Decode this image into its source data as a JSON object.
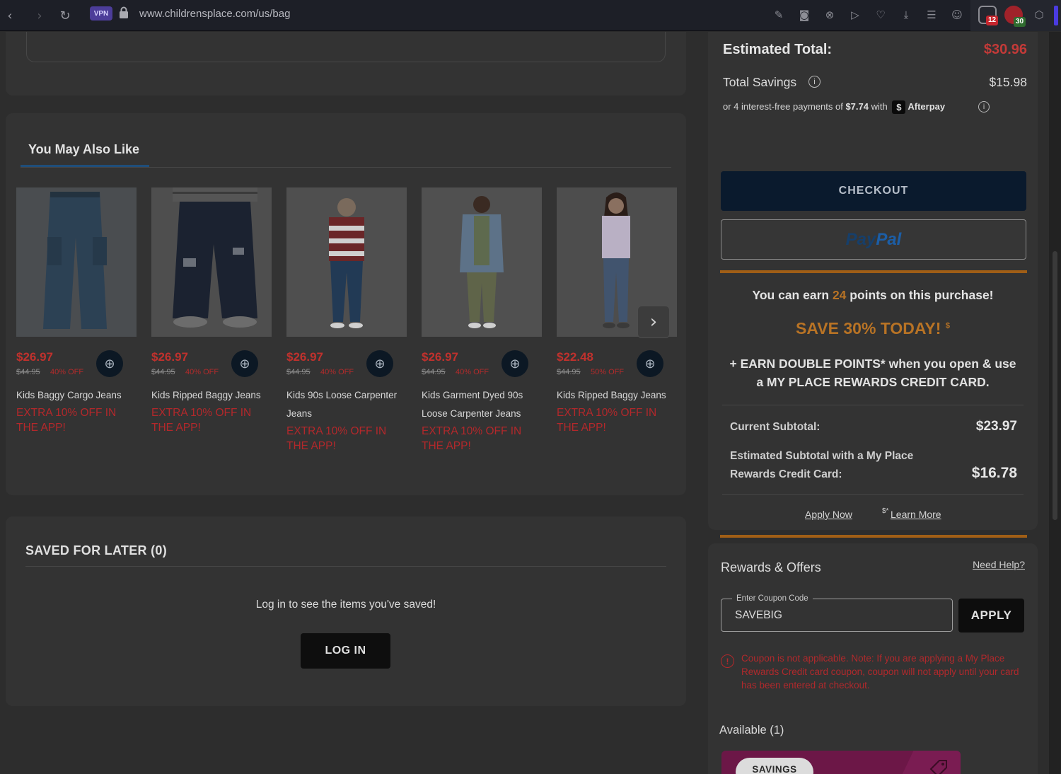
{
  "browser": {
    "vpn_label": "VPN",
    "url": "www.childrensplace.com/us/bag",
    "ext_badges": [
      "12",
      "30"
    ]
  },
  "recommendations": {
    "title": "You May Also Like",
    "products": [
      {
        "price": "$26.97",
        "original": "$44.95",
        "discount": "40% OFF",
        "name": "Kids Baggy Cargo Jeans",
        "promo": "EXTRA 10% OFF IN THE APP!"
      },
      {
        "price": "$26.97",
        "original": "$44.95",
        "discount": "40% OFF",
        "name": "Kids Ripped Baggy Jeans",
        "promo": "EXTRA 10% OFF IN THE APP!"
      },
      {
        "price": "$26.97",
        "original": "$44.95",
        "discount": "40% OFF",
        "name": "Kids 90s Loose Carpenter Jeans",
        "promo": "EXTRA 10% OFF IN THE APP!"
      },
      {
        "price": "$26.97",
        "original": "$44.95",
        "discount": "40% OFF",
        "name": "Kids Garment Dyed 90s Loose Carpenter Jeans",
        "promo": "EXTRA 10% OFF IN THE APP!"
      },
      {
        "price": "$22.48",
        "original": "$44.95",
        "discount": "50% OFF",
        "name": "Kids Ripped Baggy Jeans",
        "promo": "EXTRA 10% OFF IN THE APP!"
      }
    ]
  },
  "saved_for_later": {
    "title": "SAVED FOR LATER (0)",
    "message": "Log in to see the items you've saved!",
    "login_label": "LOG IN"
  },
  "summary": {
    "estimated_total_label": "Estimated Total:",
    "estimated_total": "$30.96",
    "total_savings_label": "Total Savings",
    "total_savings": "$15.98",
    "afterpay_prefix": "or 4 interest-free payments of",
    "afterpay_amount": "$7.74",
    "afterpay_with": "with",
    "afterpay_brand": "Afterpay",
    "checkout_label": "CHECKOUT",
    "paypal_pay": "Pay",
    "paypal_pal": "Pal"
  },
  "rewards_promo": {
    "earn_prefix": "You can earn",
    "earn_points": "24",
    "earn_suffix": "points on this purchase!",
    "save_headline": "SAVE 30% TODAY!",
    "save_mark": "$",
    "double_points": "+ EARN DOUBLE POINTS* when you open & use a MY PLACE REWARDS CREDIT CARD.",
    "current_subtotal_label": "Current Subtotal:",
    "current_subtotal": "$23.97",
    "estimated_subtotal_label": "Estimated Subtotal with a My Place Rewards Credit Card:",
    "estimated_subtotal": "$16.78",
    "apply_now": "Apply Now",
    "learn_more_mark": "$*",
    "learn_more": "Learn More"
  },
  "offers": {
    "title": "Rewards & Offers",
    "need_help": "Need Help?",
    "coupon_label": "Enter Coupon Code",
    "coupon_value": "SAVEBIG",
    "apply_label": "APPLY",
    "error": "Coupon is not applicable. Note: If you are applying a My Place Rewards Credit card coupon, coupon will not apply until your card has been entered at checkout.",
    "available": "Available (1)",
    "savings_label": "SAVINGS"
  },
  "colors": {
    "sale_red": "#c0312d",
    "points_orange": "#b87325",
    "checkout_navy": "#0a1a2d",
    "offer_magenta": "#6c1747"
  }
}
